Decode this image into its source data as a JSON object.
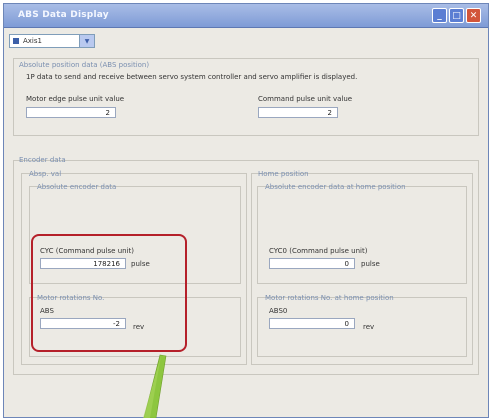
{
  "window": {
    "title": "ABS Data Display"
  },
  "titlebar": {
    "minimize": "_",
    "maximize": "□",
    "close": "✕"
  },
  "axis_select": {
    "value": "Axis1",
    "dropdown_icon": "chevron-down-icon"
  },
  "abs_position": {
    "group_title": "Absolute position data (ABS position)",
    "description": "1P data to send and receive between servo system controller and servo amplifier is displayed.",
    "motor_edge_label": "Motor edge pulse unit value",
    "motor_edge_value": "2",
    "command_label": "Command pulse unit value",
    "command_value": "2"
  },
  "encoder": {
    "group_title": "Encoder data",
    "abs_val": {
      "group_title": "Absp. val",
      "sub_title": "Absolute encoder data",
      "cyc_label": "CYC (Command pulse unit)",
      "cyc_value": "178216",
      "cyc_unit": "pulse",
      "rotations_title": "Motor rotations No.",
      "abs_label": "ABS",
      "abs_value": "-2",
      "abs_unit": "rev"
    },
    "home": {
      "group_title": "Home position",
      "sub_title": "Absolute encoder data at home position",
      "cyc0_label": "CYC0 (Command pulse unit)",
      "cyc0_value": "0",
      "cyc0_unit": "pulse",
      "rotations_title": "Motor rotations No. at home position",
      "abs0_label": "ABS0",
      "abs0_value": "0",
      "abs0_unit": "rev"
    }
  },
  "colors": {
    "highlight": "#b5202a",
    "callout": "#8dc63f"
  }
}
